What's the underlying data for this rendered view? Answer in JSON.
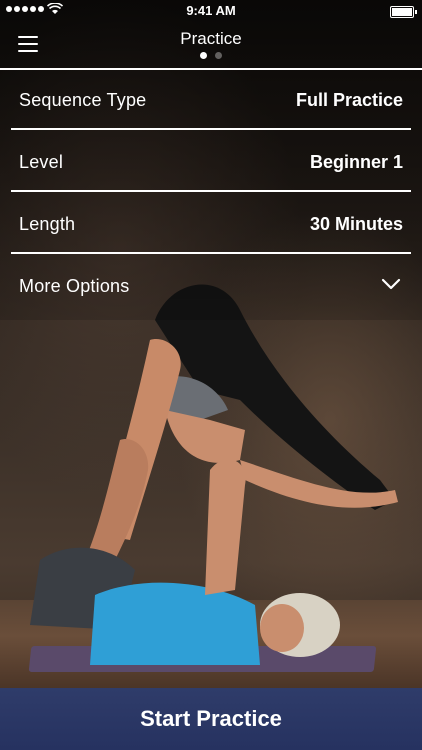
{
  "status_bar": {
    "time": "9:41 AM"
  },
  "nav": {
    "title": "Practice",
    "pages": [
      {
        "active": true
      },
      {
        "active": false
      }
    ]
  },
  "options": [
    {
      "label": "Sequence Type",
      "value": "Full Practice"
    },
    {
      "label": "Level",
      "value": "Beginner 1"
    },
    {
      "label": "Length",
      "value": "30 Minutes"
    },
    {
      "label": "More Options",
      "value": ""
    }
  ],
  "start_button": {
    "label": "Start Practice"
  },
  "colors": {
    "button_blue": "#2a376a",
    "rule_white": "#ffffff",
    "mat_purple": "#5a4a6a"
  },
  "icons": [
    "menu-icon",
    "chevron-down-icon",
    "wifi-icon",
    "battery-icon",
    "signal-icon"
  ]
}
